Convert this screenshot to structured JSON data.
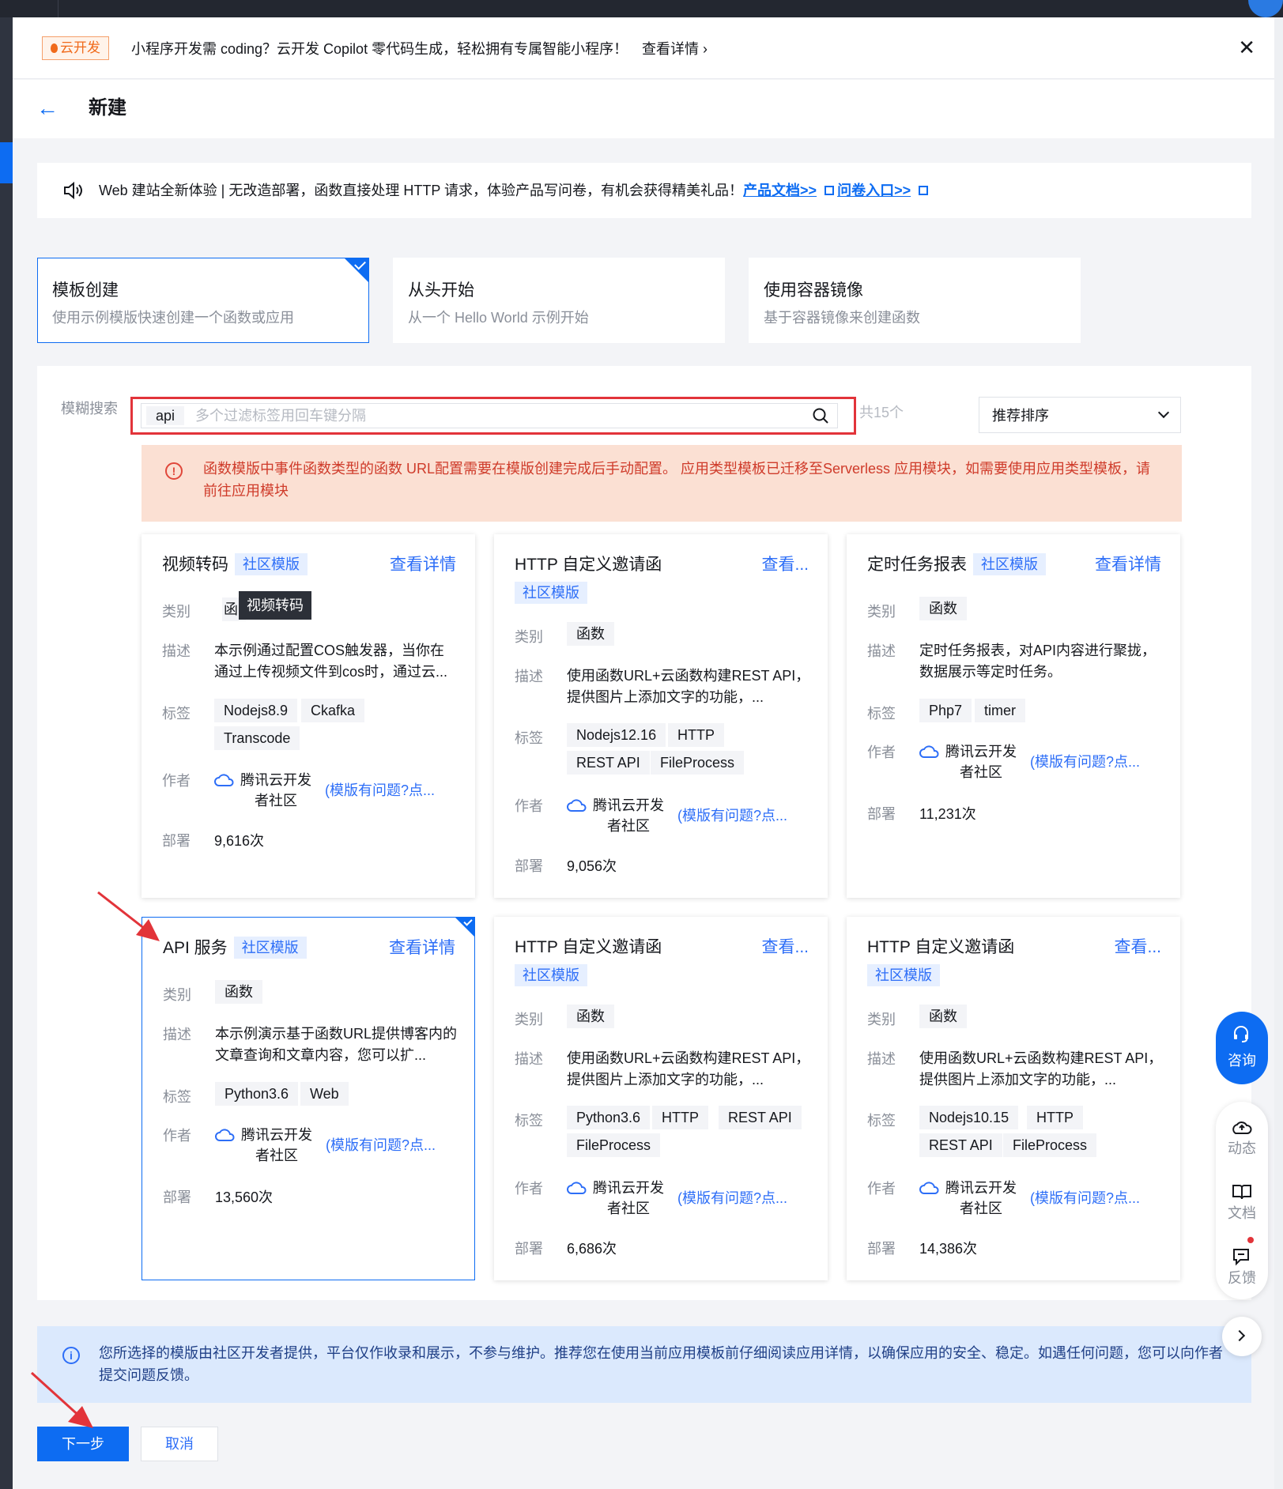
{
  "notice": {
    "tag": "云开发",
    "message": "小程序开发需 coding？云开发 Copilot 零代码生成，轻松拥有专属智能小程序！",
    "link": "查看详情 ›",
    "close": "✕"
  },
  "header": {
    "back": "←",
    "title": "新建"
  },
  "banner": {
    "text": "Web 建站全新体验 | 无改造部署，函数直接处理 HTTP 请求，体验产品写问卷，有机会获得精美礼品！",
    "link1": "产品文档>>",
    "link2": "问卷入口>>"
  },
  "modes": [
    {
      "title": "模板创建",
      "desc": "使用示例模版快速创建一个函数或应用",
      "selected": true
    },
    {
      "title": "从头开始",
      "desc": "从一个 Hello World 示例开始",
      "selected": false
    },
    {
      "title": "使用容器镜像",
      "desc": "基于容器镜像来创建函数",
      "selected": false
    }
  ],
  "filter": {
    "label": "模糊搜索",
    "chip": "api",
    "placeholder": "多个过滤标签用回车键分隔",
    "count": "共15个",
    "sort": "推荐排序"
  },
  "warning": "函数模版中事件函数类型的函数 URL配置需要在模版创建完成后手动配置。 应用类型模板已迁移至Serverless 应用模块，如需要使用应用类型模板，请前往应用模块",
  "labels": {
    "category": "类别",
    "desc": "描述",
    "tags": "标签",
    "author": "作者",
    "deploy": "部署"
  },
  "cards": [
    {
      "title": "视频转码",
      "badge": "社区模版",
      "detail": "查看详情",
      "category": "函数",
      "desc": "本示例通过配置COS触发器，当你在通过上传视频文件到cos时，通过云...",
      "tags": [
        "Nodejs8.9",
        "Ckafka",
        "Transcode"
      ],
      "author": "腾讯云开发者社区",
      "feedback": "(模版有问题?点...",
      "deploy": "9,616次"
    },
    {
      "title": "HTTP 自定义邀请函",
      "badge": "社区模版",
      "detail": "查看...",
      "category": "函数",
      "desc": "使用函数URL+云函数构建REST API，提供图片上添加文字的功能，...",
      "tags": [
        "Nodejs12.16",
        "HTTP",
        "REST API",
        "FileProcess"
      ],
      "author": "腾讯云开发者社区",
      "feedback": "(模版有问题?点...",
      "deploy": "9,056次"
    },
    {
      "title": "定时任务报表",
      "badge": "社区模版",
      "detail": "查看详情",
      "category": "函数",
      "desc": "定时任务报表，对API内容进行聚拢，数据展示等定时任务。",
      "tags": [
        "Php7",
        "timer"
      ],
      "author": "腾讯云开发者社区",
      "feedback": "(模版有问题?点...",
      "deploy": "11,231次"
    },
    {
      "title": "API 服务",
      "badge": "社区模版",
      "detail": "查看详情",
      "category": "函数",
      "desc": "本示例演示基于函数URL提供博客内的文章查询和文章内容，您可以扩...",
      "tags": [
        "Python3.6",
        "Web"
      ],
      "author": "腾讯云开发者社区",
      "feedback": "(模版有问题?点...",
      "deploy": "13,560次"
    },
    {
      "title": "HTTP 自定义邀请函",
      "badge": "社区模版",
      "detail": "查看...",
      "category": "函数",
      "desc": "使用函数URL+云函数构建REST API，提供图片上添加文字的功能，...",
      "tags": [
        "Python3.6",
        "HTTP",
        "REST API",
        "FileProcess"
      ],
      "author": "腾讯云开发者社区",
      "feedback": "(模版有问题?点...",
      "deploy": "6,686次"
    },
    {
      "title": "HTTP 自定义邀请函",
      "badge": "社区模版",
      "detail": "查看...",
      "category": "函数",
      "desc": "使用函数URL+云函数构建REST API，提供图片上添加文字的功能，...",
      "tags": [
        "Nodejs10.15",
        "HTTP",
        "REST API",
        "FileProcess"
      ],
      "author": "腾讯云开发者社区",
      "feedback": "(模版有问题?点...",
      "deploy": "14,386次"
    }
  ],
  "tooltip": "视频转码",
  "tooltip_under": "函",
  "info": "您所选择的模版由社区开发者提供，平台仅作收录和展示，不参与维护。推荐您在使用当前应用模板前仔细阅读应用详情，以确保应用的安全、稳定。如遇任何问题，您可以向作者提交问题反馈。",
  "buttons": {
    "next": "下一步",
    "cancel": "取消"
  },
  "sidebar": {
    "consult": "咨询",
    "activity": "动态",
    "docs": "文档",
    "feedback": "反馈"
  },
  "colors": {
    "primary": "#0d6cf2",
    "highlight": "#e2343a",
    "warn_bg": "#fbe0d3",
    "info_bg": "#dbe9fd"
  }
}
